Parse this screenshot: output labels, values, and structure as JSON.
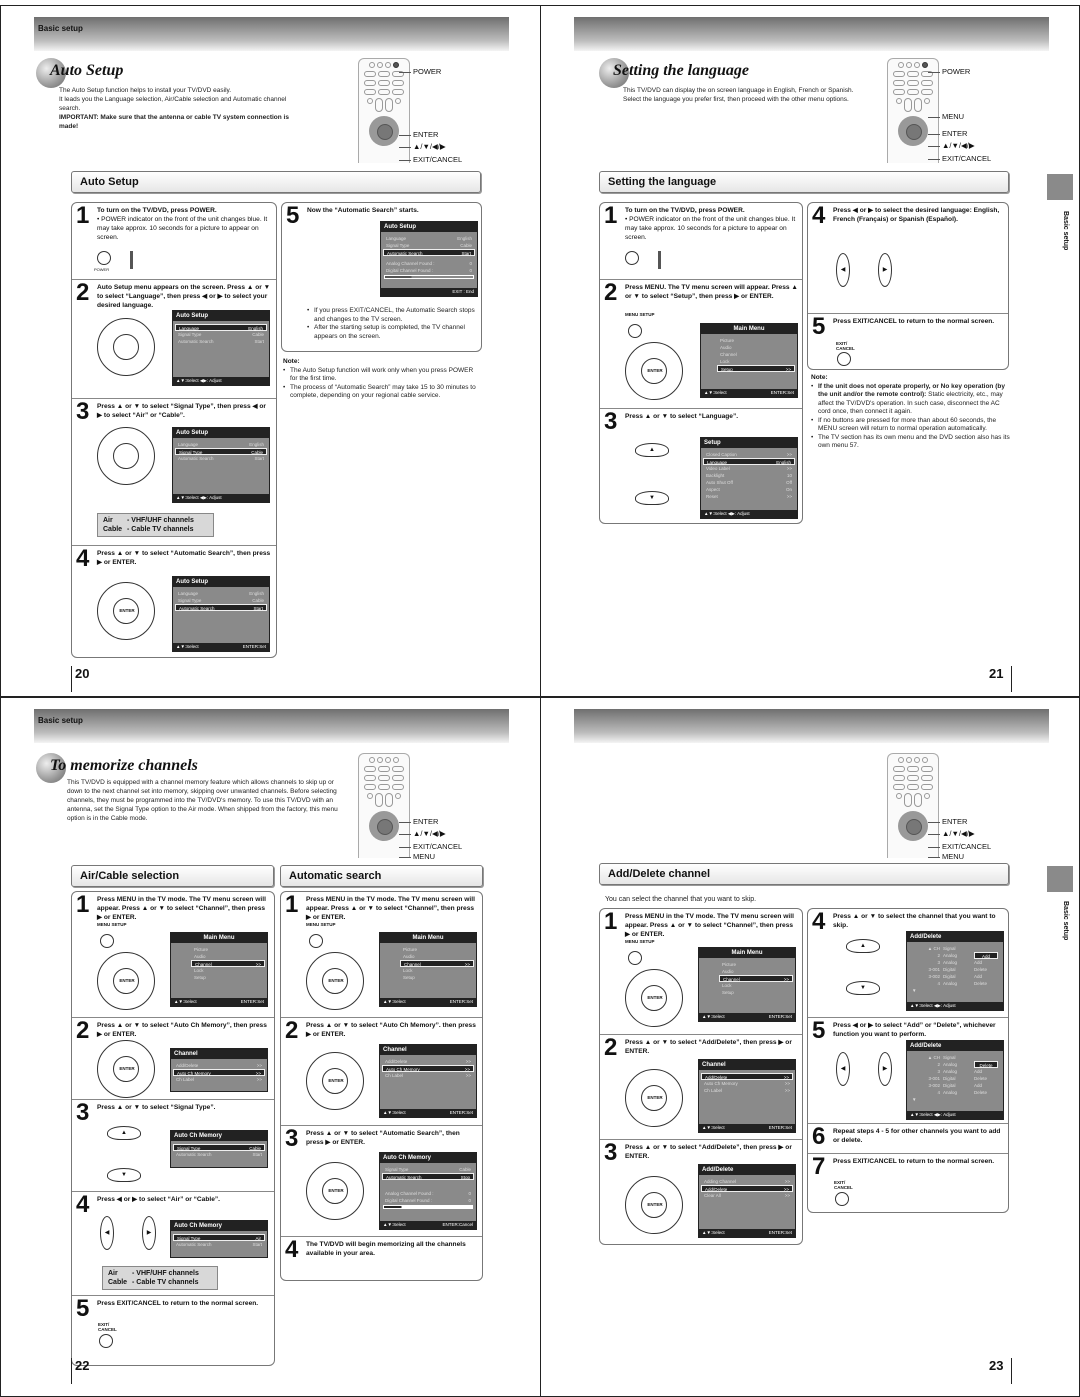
{
  "pages": {
    "p20": {
      "header_label": "Basic setup",
      "title": "Auto Setup",
      "intro": [
        "The Auto Setup function helps to install your TV/DVD easily.",
        "It leads you the Language selection, Air/Cable selection and Automatic channel search."
      ],
      "important": "IMPORTANT: Make sure that the antenna or cable TV system connection is made!",
      "remote_labels": [
        "POWER",
        "ENTER",
        "▲/▼/◀/▶",
        "EXIT/CANCEL"
      ],
      "section": "Auto Setup",
      "steps": [
        {
          "n": "1",
          "text": "To turn on the TV/DVD, press POWER.",
          "sub": "• POWER indicator on the front of the unit changes blue. It may take approx. 10 seconds for a picture to appear on screen.",
          "power_label": "POWER"
        },
        {
          "n": "2",
          "text": "Auto Setup menu appears on the screen. Press ▲ or ▼ to select “Language”, then press ◀ or ▶ to select your desired language."
        },
        {
          "n": "3",
          "text": "Press ▲ or ▼ to select “Signal Type”, then press ◀ or ▶ to select “Air” or “Cable”."
        },
        {
          "n": "4",
          "text": "Press ▲ or ▼ to select “Automatic Search”, then press ▶ or ENTER."
        },
        {
          "n": "5",
          "text": "Now the “Automatic Search” starts."
        }
      ],
      "osd_title": "Auto Setup",
      "osd_rows": [
        [
          "Language",
          "English"
        ],
        [
          "Signal Type",
          "Cable"
        ],
        [
          "Automatic Search",
          "Start"
        ]
      ],
      "osd_found": [
        [
          "Analog Channel Found :",
          "0"
        ],
        [
          "Digital Channel Found :",
          "0"
        ]
      ],
      "footer_adjust": "▲▼:Select  ◀▶: Adjust",
      "footer_select": "▲▼:Select",
      "footer_set": "ENTER:Set",
      "footer_end": "EXIT : End",
      "enter_label": "ENTER",
      "legend": [
        [
          "Air",
          "- VHF/UHF channels"
        ],
        [
          "Cable",
          "- Cable TV channels"
        ]
      ],
      "step5_bullets": [
        "If you press EXIT/CANCEL, the Automatic Search stops and changes to the TV screen.",
        "After the starting setup is completed, the TV channel appears on the screen."
      ],
      "note_head": "Note:",
      "notes": [
        "The Auto Setup function will work only when you press POWER for the first time.",
        "The process of “Automatic Search” may take 15 to 30 minutes to complete, depending on your regional cable service."
      ],
      "page_number": "20"
    },
    "p21": {
      "title": "Setting the language",
      "intro": [
        "This TV/DVD can display the on screen language in English, French or Spanish.",
        "Select the language you prefer first, then proceed with the other menu options."
      ],
      "remote_labels": [
        "POWER",
        "MENU",
        "ENTER",
        "▲/▼/◀/▶",
        "EXIT/CANCEL"
      ],
      "section": "Setting the language",
      "side_label": "Basic setup",
      "steps": [
        {
          "n": "1",
          "text": "To turn on the TV/DVD, press POWER.",
          "sub": "• POWER indicator on the front of the unit changes blue. It may take approx. 10 seconds for a picture to appear on screen."
        },
        {
          "n": "2",
          "text": "Press MENU. The TV menu screen will appear. Press ▲ or ▼ to select “Setup”, then press ▶ or ENTER."
        },
        {
          "n": "3",
          "text": "Press ▲ or ▼ to select “Language”."
        },
        {
          "n": "4",
          "text": "Press ◀ or ▶ to select the desired language: English, French (Français) or Spanish (Español)."
        },
        {
          "n": "5",
          "text": "Press EXIT/CANCEL to return to the normal screen."
        }
      ],
      "menu_label": "MENU SETUP",
      "exit_label": "EXIT/ CANCEL",
      "main_menu_title": "Main Menu",
      "main_menu_items": [
        "Picture",
        "Audio",
        "Channel",
        "Lock",
        "Setup"
      ],
      "setup_title": "Setup",
      "setup_rows": [
        [
          "Closed Caption",
          ">>"
        ],
        [
          "Language",
          "English"
        ],
        [
          "Video Label",
          ">>"
        ],
        [
          "Backlight",
          "10"
        ],
        [
          "Auto Shut Off",
          "Off"
        ],
        [
          "Aspect",
          "On"
        ],
        [
          "Reset",
          ">>"
        ]
      ],
      "backlight_level": 0.5,
      "note_head": "Note:",
      "notes": [
        {
          "bold": "If the unit does not operate properly, or No key operation (by the unit and/or the remote control):",
          "text": "Static electricity, etc., may affect the TV/DVD's operation. In such case, disconnect the AC cord once, then connect it again."
        },
        {
          "bold": "",
          "text": "If no buttons are pressed for more than about 60 seconds, the MENU screen will return to normal operation automatically."
        },
        {
          "bold": "",
          "text": "The TV section has its own menu and the DVD section also has its own menu 57."
        }
      ],
      "page_number": "21"
    },
    "p22": {
      "header_label": "Basic setup",
      "title": "To memorize channels",
      "intro": "This TV/DVD is equipped with a channel memory feature which allows channels to skip up or down to the next channel set into memory, skipping over unwanted channels. Before selecting channels, they must be programmed into the TV/DVD's memory. To use this TV/DVD with an antenna, set the Signal Type option to the Air mode. When shipped from the factory, this menu option is in the Cable mode.",
      "remote_labels": [
        "ENTER",
        "▲/▼/◀/▶",
        "EXIT/CANCEL",
        "MENU"
      ],
      "section_left": "Air/Cable selection",
      "section_right": "Automatic search",
      "left_steps": [
        {
          "n": "1",
          "text": "Press MENU in the TV mode. The TV menu screen will appear. Press ▲ or ▼ to select “Channel”, then press ▶ or ENTER."
        },
        {
          "n": "2",
          "text": "Press ▲ or ▼ to select “Auto Ch Memory”, then press ▶ or ENTER."
        },
        {
          "n": "3",
          "text": "Press ▲ or ▼ to select “Signal Type”."
        },
        {
          "n": "4",
          "text": "Press ◀ or ▶ to select “Air” or “Cable”."
        },
        {
          "n": "5",
          "text": "Press EXIT/CANCEL to return to the normal screen."
        }
      ],
      "right_steps": [
        {
          "n": "1",
          "text": "Press MENU in the TV mode. The TV menu screen will appear. Press ▲ or ▼ to select “Channel”, then press ▶ or ENTER."
        },
        {
          "n": "2",
          "text": "Press ▲ or ▼ to select “Auto Ch Memory”. then press ▶ or ENTER."
        },
        {
          "n": "3",
          "text": "Press ▲ or ▼ to select “Automatic Search”, then press ▶ or ENTER."
        },
        {
          "n": "4",
          "text": "The TV/DVD will begin memorizing all the channels available in your area."
        }
      ],
      "channel_title": "Channel",
      "channel_rows": [
        [
          "Add/Delete",
          ">>"
        ],
        [
          "Auto Ch Memory",
          ">>"
        ],
        [
          "Ch Label",
          ">>"
        ]
      ],
      "acm_title": "Auto Ch Memory",
      "acm_rows_cable": [
        [
          "Signal Type",
          "Cable"
        ],
        [
          "Automatic Search",
          "Start"
        ]
      ],
      "acm_rows_air": [
        [
          "Signal Type",
          "Air"
        ],
        [
          "Automatic Search",
          "Start"
        ]
      ],
      "acm_rows_search": [
        [
          "Signal Type",
          "Cable"
        ],
        [
          "Automatic Search",
          "Stop"
        ]
      ],
      "acm_found": [
        [
          "Analog Channel Found :",
          "0"
        ],
        [
          "Digital Channel Found :",
          "0"
        ]
      ],
      "footer_cancel": "ENTER:Cancel",
      "legend": [
        [
          "Air",
          "- VHF/UHF channels"
        ],
        [
          "Cable",
          "- Cable TV channels"
        ]
      ],
      "page_number": "22"
    },
    "p23": {
      "remote_labels": [
        "ENTER",
        "▲/▼/◀/▶",
        "EXIT/CANCEL",
        "MENU"
      ],
      "section": "Add/Delete channel",
      "side_label": "Basic setup",
      "intro": "You can select the channel that you want to skip.",
      "steps": [
        {
          "n": "1",
          "text": "Press MENU in the TV mode. The TV menu screen will appear. Press ▲ or ▼ to select “Channel”, then press ▶ or ENTER."
        },
        {
          "n": "2",
          "text": "Press ▲ or ▼ to select “Add/Delete”, then press ▶ or ENTER."
        },
        {
          "n": "3",
          "text": "Press ▲ or ▼ to select “Add/Delete”, then press ▶ or ENTER."
        },
        {
          "n": "4",
          "text": "Press ▲ or ▼ to select the channel that you want to skip."
        },
        {
          "n": "5",
          "text": "Press ◀ or ▶ to select “Add” or “Delete”, whichever function you want to perform."
        },
        {
          "n": "6",
          "text": "Repeat steps 4 - 5 for other channels you want to add or delete."
        },
        {
          "n": "7",
          "text": "Press EXIT/CANCEL to return to the normal screen."
        }
      ],
      "adddel_title": "Add/Delete",
      "adddel_menu_rows": [
        [
          "Adding Channel",
          ">>"
        ],
        [
          "Add/Delete",
          ">>"
        ],
        [
          "Clear All",
          ">>"
        ]
      ],
      "ch_header": [
        "▲ CH",
        "Signal",
        ""
      ],
      "ch_rows_a": [
        [
          "2",
          "Analog",
          "Add"
        ],
        [
          "3",
          "Analog",
          "Add"
        ],
        [
          "3-001",
          "Digital",
          "Delete"
        ],
        [
          "3-002",
          "Digital",
          "Add"
        ],
        [
          "4",
          "Analog",
          "Delete"
        ]
      ],
      "ch_rows_b": [
        [
          "2",
          "Analog",
          "Delete"
        ],
        [
          "3",
          "Analog",
          "Add"
        ],
        [
          "3-001",
          "Digital",
          "Delete"
        ],
        [
          "3-002",
          "Digital",
          "Add"
        ],
        [
          "4",
          "Analog",
          "Delete"
        ]
      ],
      "page_number": "23"
    }
  }
}
